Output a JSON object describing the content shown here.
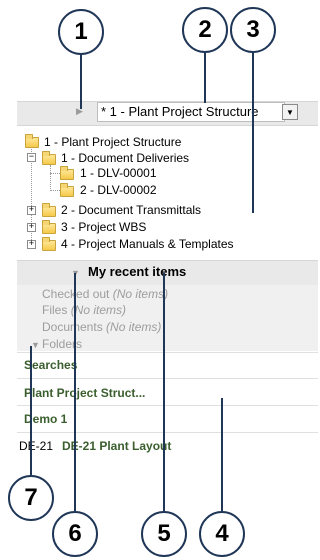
{
  "callouts": [
    "1",
    "2",
    "3",
    "4",
    "5",
    "6",
    "7"
  ],
  "dropdown": {
    "selected": "* 1 - Plant Project Structure"
  },
  "tree": {
    "root": "1 - Plant Project Structure",
    "deliveries": "1 - Document Deliveries",
    "dlv1": "1 - DLV-00001",
    "dlv2": "2 - DLV-00002",
    "transmittals": "2 - Document Transmittals",
    "wbs": "3 - Project WBS",
    "manuals": "4 - Project Manuals & Templates"
  },
  "recent": {
    "title": "My recent items",
    "checked_out": "Checked out",
    "files": "Files",
    "documents": "Documents",
    "no_items": "(No items)",
    "folders": "Folders"
  },
  "list": {
    "searches": "Searches",
    "plant_project": "Plant Project Struct...",
    "demo": "Demo 1",
    "de21_prefix": "DE-21",
    "de21_label": "DE-21 Plant Layout"
  }
}
